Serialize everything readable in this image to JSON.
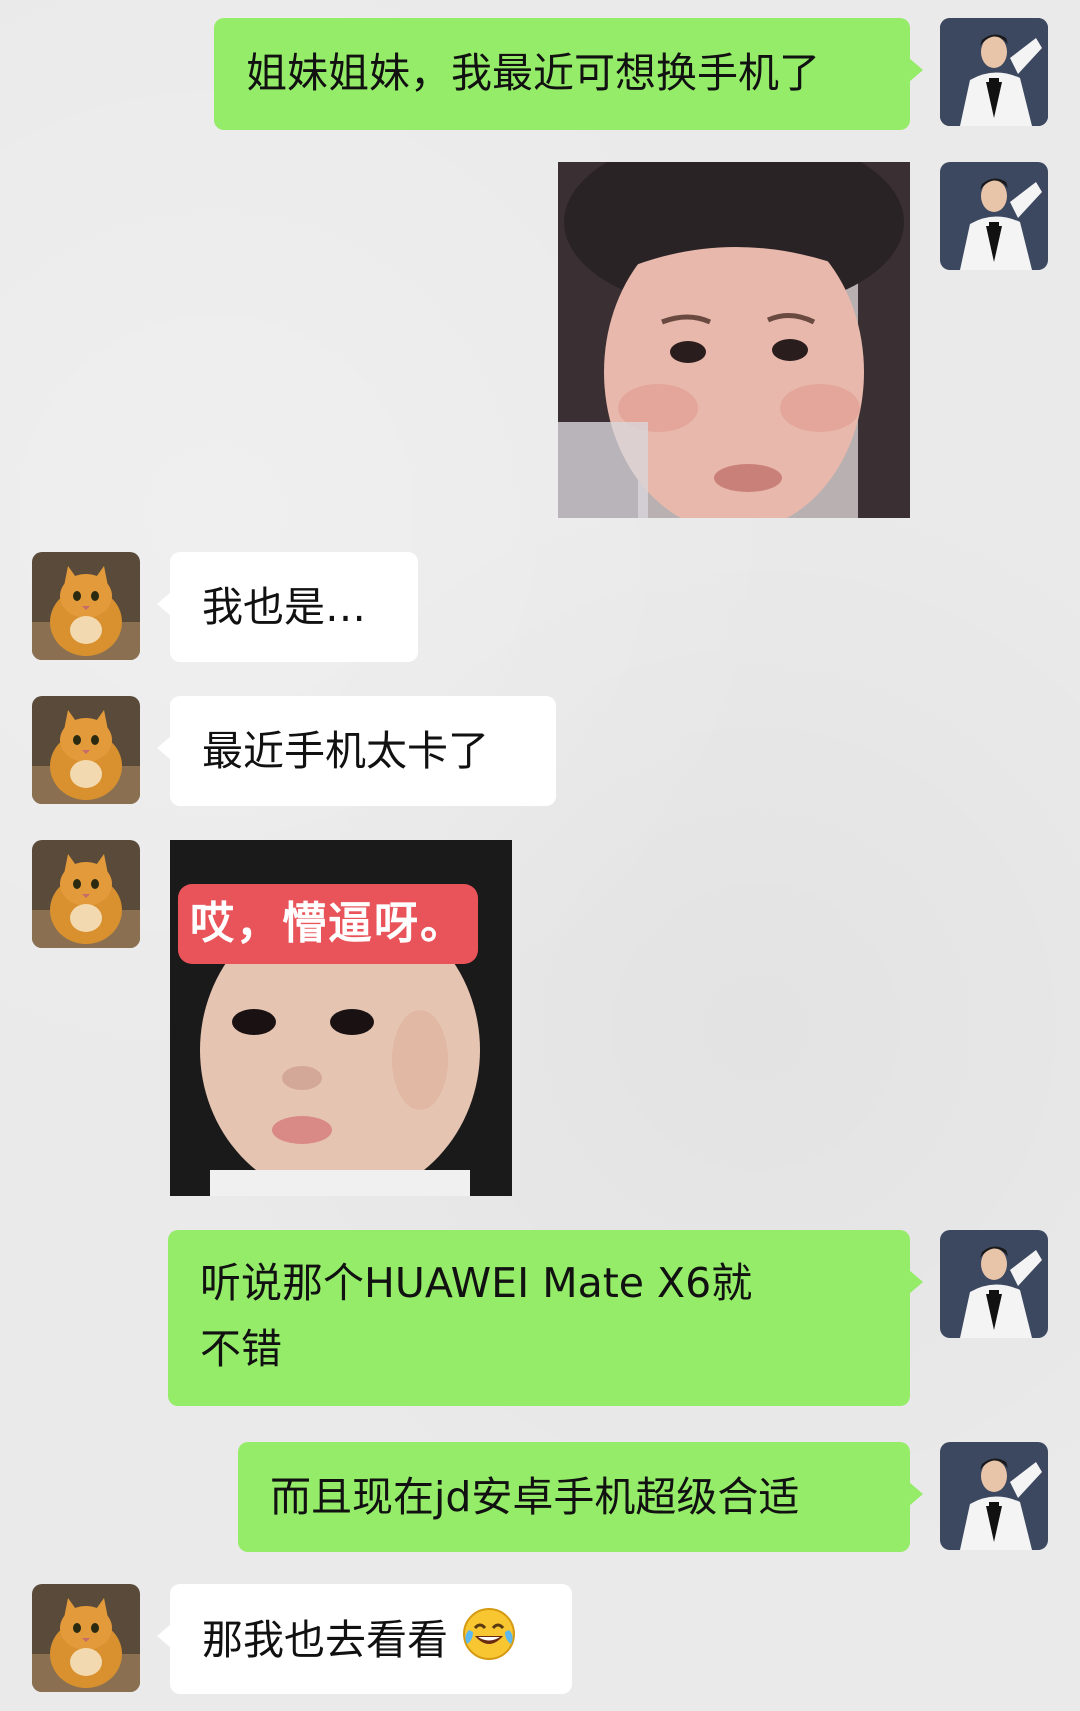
{
  "messages": {
    "m1": {
      "text": "姐妹姐妹，我最近可想换手机了",
      "sender": "me"
    },
    "m2": {
      "image": "crying-girl-meme",
      "sender": "me"
    },
    "m3": {
      "text": "我也是…",
      "sender": "friend"
    },
    "m4": {
      "text": "最近手机太卡了",
      "sender": "friend"
    },
    "m5": {
      "image": "confused-baby-meme",
      "caption": "哎，懵逼呀。",
      "sender": "friend"
    },
    "m6": {
      "line1": "听说那个HUAWEI Mate X6就",
      "line2": "不错",
      "sender": "me"
    },
    "m7": {
      "text": "而且现在jd安卓手机超级合适",
      "sender": "me"
    },
    "m8": {
      "text": "那我也去看看",
      "emoji": "tears-of-joy-emoji",
      "sender": "friend"
    }
  },
  "avatars": {
    "me": "man-in-white-tuxedo-avatar",
    "friend": "orange-cat-avatar"
  },
  "colors": {
    "background": "#eaeaea",
    "sent_bubble": "#95ec69",
    "received_bubble": "#ffffff",
    "caption_banner": "#e8545a"
  }
}
